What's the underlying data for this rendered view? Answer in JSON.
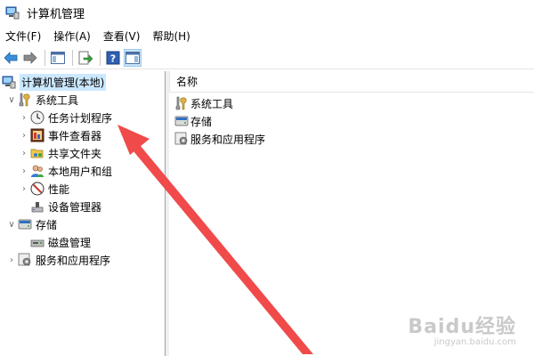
{
  "window": {
    "title": "计算机管理"
  },
  "menu": [
    {
      "label": "文件(F)"
    },
    {
      "label": "操作(A)"
    },
    {
      "label": "查看(V)"
    },
    {
      "label": "帮助(H)"
    }
  ],
  "tree": {
    "root": "计算机管理(本地)",
    "system_tools": "系统工具",
    "task_scheduler": "任务计划程序",
    "event_viewer": "事件查看器",
    "shared_folders": "共享文件夹",
    "local_users": "本地用户和组",
    "performance": "性能",
    "device_manager": "设备管理器",
    "storage": "存储",
    "disk_management": "磁盘管理",
    "services_apps": "服务和应用程序"
  },
  "list": {
    "column_name": "名称",
    "items": [
      {
        "label": "系统工具"
      },
      {
        "label": "存储"
      },
      {
        "label": "服务和应用程序"
      }
    ]
  },
  "watermark": {
    "brand": "Baidu经验",
    "url": "jingyan.baidu.com"
  },
  "colors": {
    "annotation_arrow": "#f04a4a",
    "selection": "#cce8ff"
  }
}
